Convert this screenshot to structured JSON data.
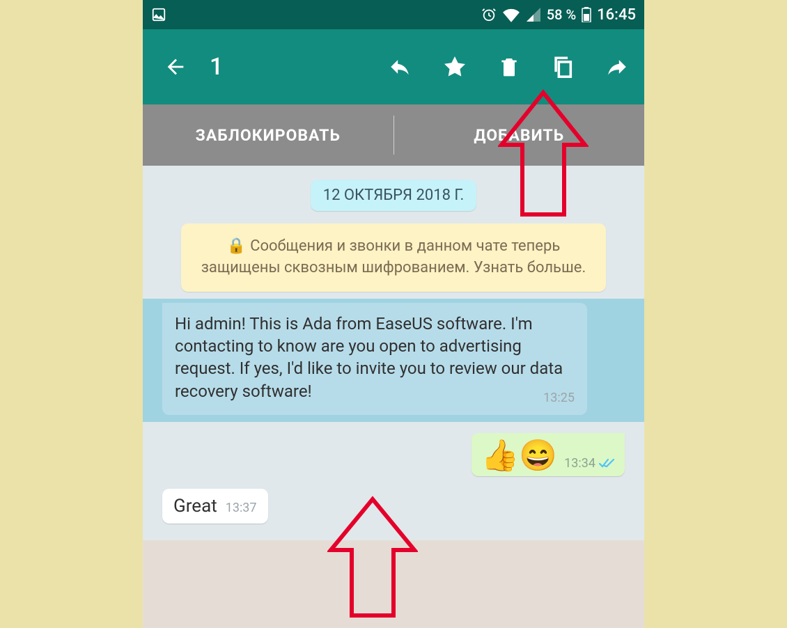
{
  "status": {
    "battery_pct": "58 %",
    "time": "16:45"
  },
  "toolbar": {
    "selected_count": "1"
  },
  "action_bar": {
    "block": "ЗАБЛОКИРОВАТЬ",
    "add": "ДОБАВИТЬ"
  },
  "chat": {
    "date": "12 ОКТЯБРЯ 2018 Г.",
    "encryption": "Сообщения и звонки в данном чате теперь защищены сквозным шифрованием. Узнать больше.",
    "msg1_text": "Hi admin! This is Ada from EaseUS software. I'm contacting to know are you open to advertising request. If yes, I'd like to invite you to review our data recovery software!",
    "msg1_time": "13:25",
    "msg2_emoji": "👍😄",
    "msg2_time": "13:34",
    "msg3_text": "Great",
    "msg3_time": "13:37"
  }
}
